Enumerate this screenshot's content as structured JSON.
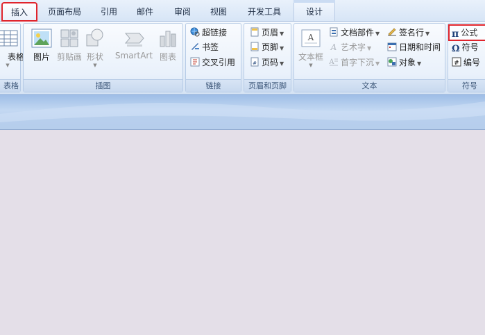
{
  "tabs": [
    {
      "label": "插入",
      "active": true
    },
    {
      "label": "页面布局"
    },
    {
      "label": "引用"
    },
    {
      "label": "邮件"
    },
    {
      "label": "审阅"
    },
    {
      "label": "视图"
    },
    {
      "label": "开发工具"
    },
    {
      "label": "设计",
      "contextual": true
    }
  ],
  "groups": {
    "table": {
      "label": "表格",
      "btn": "表格"
    },
    "illustrations": {
      "label": "插图",
      "picture": "图片",
      "clipart": "剪贴画",
      "shapes": "形状",
      "smartart": "SmartArt",
      "chart": "图表"
    },
    "links": {
      "label": "链接",
      "hyperlink": "超链接",
      "bookmark": "书签",
      "crossref": "交叉引用"
    },
    "headerfooter": {
      "label": "页眉和页脚",
      "header": "页眉",
      "footer": "页脚",
      "pagenum": "页码"
    },
    "text": {
      "label": "文本",
      "textbox": "文本框",
      "quickparts": "文档部件",
      "wordart": "艺术字",
      "dropcap": "首字下沉",
      "signature": "签名行",
      "datetime": "日期和时间",
      "object": "对象"
    },
    "symbols": {
      "label": "符号",
      "equation": "公式",
      "symbol": "符号",
      "number": "编号"
    }
  },
  "colors": {
    "highlight": "#e0242c",
    "ribbon": "#dbe7f6",
    "page": "#e4dfe8"
  }
}
